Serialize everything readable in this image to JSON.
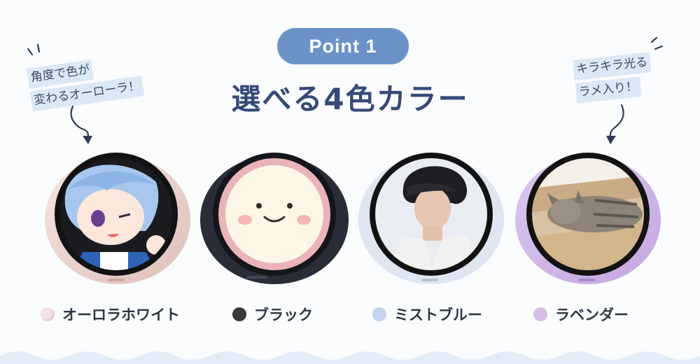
{
  "badge": "Point 1",
  "title": "選べる4色カラー",
  "notes": {
    "left": [
      "角度で色が",
      "変わるオーローラ！"
    ],
    "right": [
      "キラキラ光る",
      "ラメ入り！"
    ]
  },
  "products": [
    {
      "name": "オーロラホワイト",
      "body_color": "#f1ddd6",
      "dot_color": "#f3e3e6",
      "image": "anime-character"
    },
    {
      "name": "ブラック",
      "body_color": "#2b2f3a",
      "dot_color": "#3a3a3a",
      "image": "smiley-face"
    },
    {
      "name": "ミストブルー",
      "body_color": "#dde4f1",
      "dot_color": "#c2d4ef",
      "image": "man-portrait"
    },
    {
      "name": "ラベンダー",
      "body_color": "#d3bde8",
      "dot_color": "#d6bde8",
      "image": "cat-photo"
    }
  ]
}
